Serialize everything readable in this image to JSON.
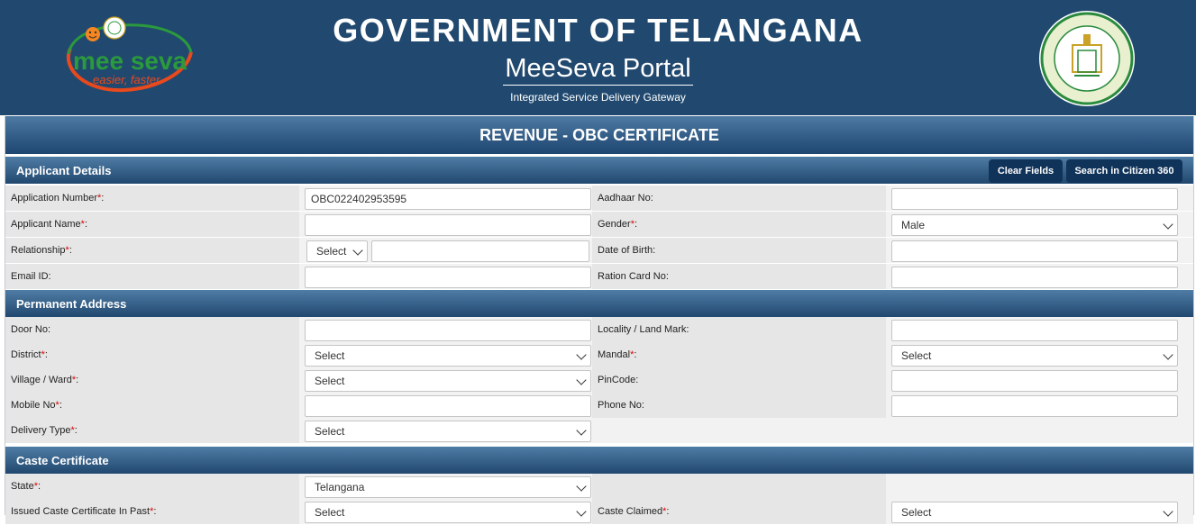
{
  "header": {
    "title": "GOVERNMENT OF TELANGANA",
    "portal": "MeeSeva Portal",
    "tagline": "Integrated Service Delivery Gateway",
    "logo_left": {
      "brand": "mee seva",
      "slogan": "easier, faster"
    },
    "logo_right_icon": "telangana-state-emblem"
  },
  "page": {
    "title": "REVENUE - OBC CERTIFICATE"
  },
  "applicant": {
    "section_title": "Applicant Details",
    "clear_label": "Clear Fields",
    "search_label": "Search in Citizen 360",
    "application_number": {
      "label": "Application Number",
      "value": "OBC022402953595"
    },
    "aadhaar": {
      "label": "Aadhaar No:"
    },
    "applicant_name": {
      "label": "Applicant Name"
    },
    "gender": {
      "label": "Gender",
      "value": "Male"
    },
    "relationship": {
      "label": "Relationship",
      "value": "Select"
    },
    "dob": {
      "label": "Date of Birth:"
    },
    "email": {
      "label": "Email ID:"
    },
    "ration": {
      "label": "Ration Card No:"
    }
  },
  "address": {
    "section_title": "Permanent Address",
    "door": {
      "label": "Door No:"
    },
    "locality": {
      "label": "Locality / Land Mark:"
    },
    "district": {
      "label": "District",
      "value": "Select"
    },
    "mandal": {
      "label": "Mandal",
      "value": "Select"
    },
    "village": {
      "label": "Village / Ward",
      "value": "Select"
    },
    "pincode": {
      "label": "PinCode:"
    },
    "mobile": {
      "label": "Mobile No"
    },
    "phone": {
      "label": "Phone No:"
    },
    "delivery": {
      "label": "Delivery Type",
      "value": "Select"
    }
  },
  "caste": {
    "section_title": "Caste Certificate",
    "state": {
      "label": "State",
      "value": "Telangana"
    },
    "issued": {
      "label": "Issued Caste Certificate In Past",
      "value": "Select"
    },
    "claimed": {
      "label": "Caste Claimed",
      "value": "Select"
    }
  },
  "colors": {
    "header_bg": "#21496f",
    "section_bg": "#21486f",
    "button_bg": "#10335a",
    "required": "#e00000"
  }
}
